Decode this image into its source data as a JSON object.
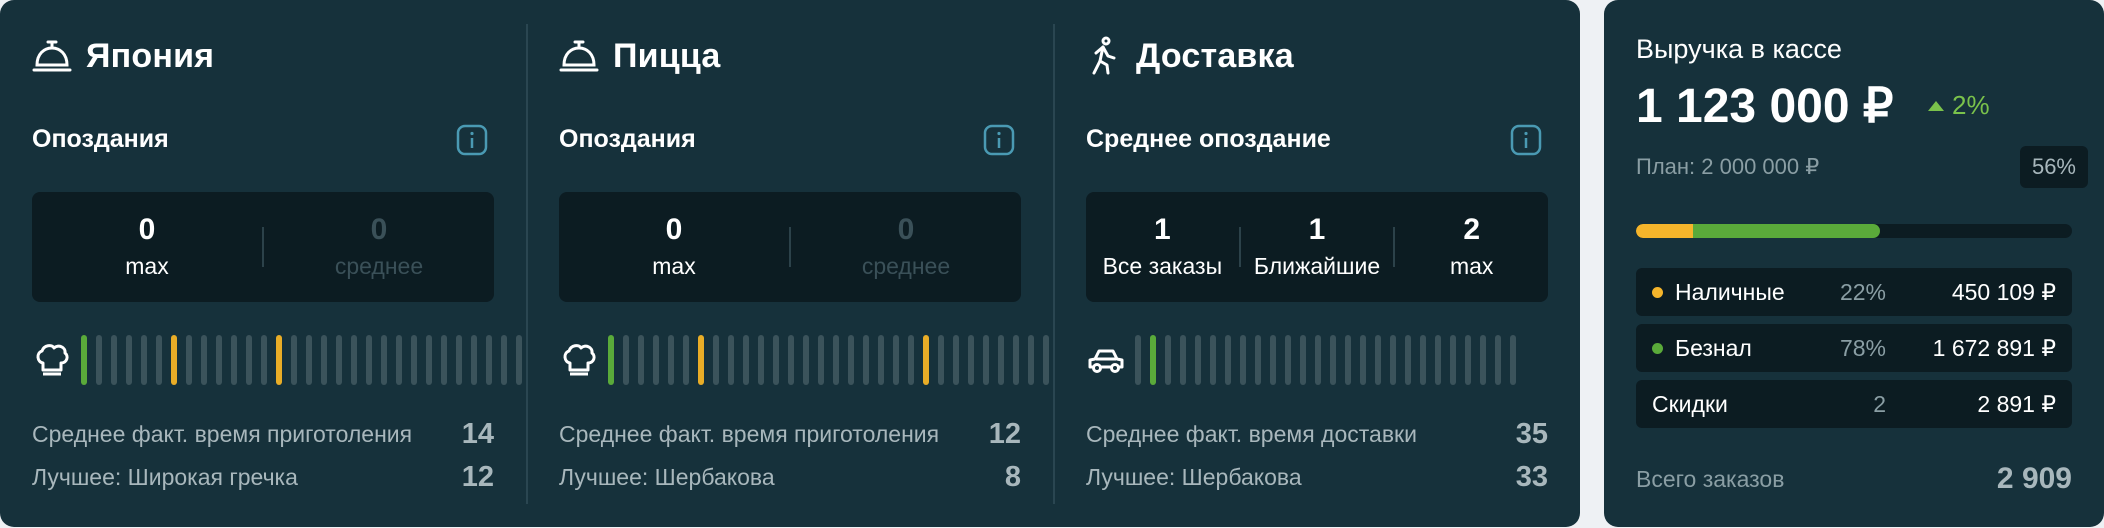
{
  "colors": {
    "card_bg": "#16313b",
    "inner_bg": "#0c1c22",
    "green": "#5aaa3a",
    "yellow": "#e9ad27",
    "info": "#4a9ab3",
    "bar_idle": "#3b535b"
  },
  "columns": [
    {
      "icon": "cloche-icon",
      "title": "Япония",
      "subtitle": "Опоздания",
      "stats": [
        {
          "value": "0",
          "label": "max",
          "dim": false
        },
        {
          "value": "0",
          "label": "среднее",
          "dim": true
        }
      ],
      "bars_icon": "chef-hat-icon",
      "bars": [
        "g",
        "n",
        "n",
        "n",
        "n",
        "n",
        "y",
        "n",
        "n",
        "n",
        "n",
        "n",
        "n",
        "y",
        "n",
        "n",
        "n",
        "n",
        "n",
        "n",
        "n",
        "n",
        "n",
        "n",
        "n",
        "n",
        "n",
        "n",
        "n",
        "n"
      ],
      "metrics": [
        {
          "label": "Среднее факт. время приготоления",
          "value": "14"
        },
        {
          "label": "Лучшее: Широкая гречка",
          "value": "12"
        }
      ]
    },
    {
      "icon": "cloche-icon",
      "title": "Пицца",
      "subtitle": "Опоздания",
      "stats": [
        {
          "value": "0",
          "label": "max",
          "dim": false
        },
        {
          "value": "0",
          "label": "среднее",
          "dim": true
        }
      ],
      "bars_icon": "chef-hat-icon",
      "bars": [
        "g",
        "n",
        "n",
        "n",
        "n",
        "n",
        "y",
        "n",
        "n",
        "n",
        "n",
        "n",
        "n",
        "n",
        "n",
        "n",
        "n",
        "n",
        "n",
        "n",
        "n",
        "y",
        "n",
        "n",
        "n",
        "n",
        "n",
        "n",
        "n",
        "n"
      ],
      "metrics": [
        {
          "label": "Среднее факт. время приготоления",
          "value": "12"
        },
        {
          "label": "Лучшее: Шербакова",
          "value": "8"
        }
      ]
    },
    {
      "icon": "walking-person-icon",
      "title": "Доставка",
      "subtitle": "Среднее опоздание",
      "stats": [
        {
          "value": "1",
          "label": "Все заказы",
          "dim": false
        },
        {
          "value": "1",
          "label": "Ближайшие",
          "dim": false
        },
        {
          "value": "2",
          "label": "max",
          "dim": false
        }
      ],
      "bars_icon": "car-icon",
      "bars": [
        "n",
        "g",
        "n",
        "n",
        "n",
        "n",
        "n",
        "n",
        "n",
        "n",
        "n",
        "n",
        "n",
        "n",
        "n",
        "n",
        "n",
        "n",
        "n",
        "n",
        "n",
        "n",
        "n",
        "n",
        "n",
        "n"
      ],
      "metrics": [
        {
          "label": "Среднее факт. время доставки",
          "value": "35"
        },
        {
          "label": "Лучшее: Шербакова",
          "value": "33"
        }
      ]
    }
  ],
  "revenue": {
    "title": "Выручка в кассе",
    "amount": "1 123 000 ₽",
    "change": "2%",
    "change_direction": "up",
    "plan_label": "План: 2 000 000 ₽",
    "plan_percent": "56%",
    "progress": {
      "cash_fraction": 0.13,
      "card_fraction": 0.43
    },
    "rows": [
      {
        "label": "Наличные",
        "percent": "22%",
        "amount": "450 109 ₽",
        "dot": "#f5b52b"
      },
      {
        "label": "Безнал",
        "percent": "78%",
        "amount": "1 672 891 ₽",
        "dot": "#5aaa3a"
      },
      {
        "label": "Скидки",
        "percent": "2",
        "amount": "2 891 ₽",
        "dot": ""
      }
    ],
    "total_label": "Всего заказов",
    "total_value": "2 909"
  }
}
